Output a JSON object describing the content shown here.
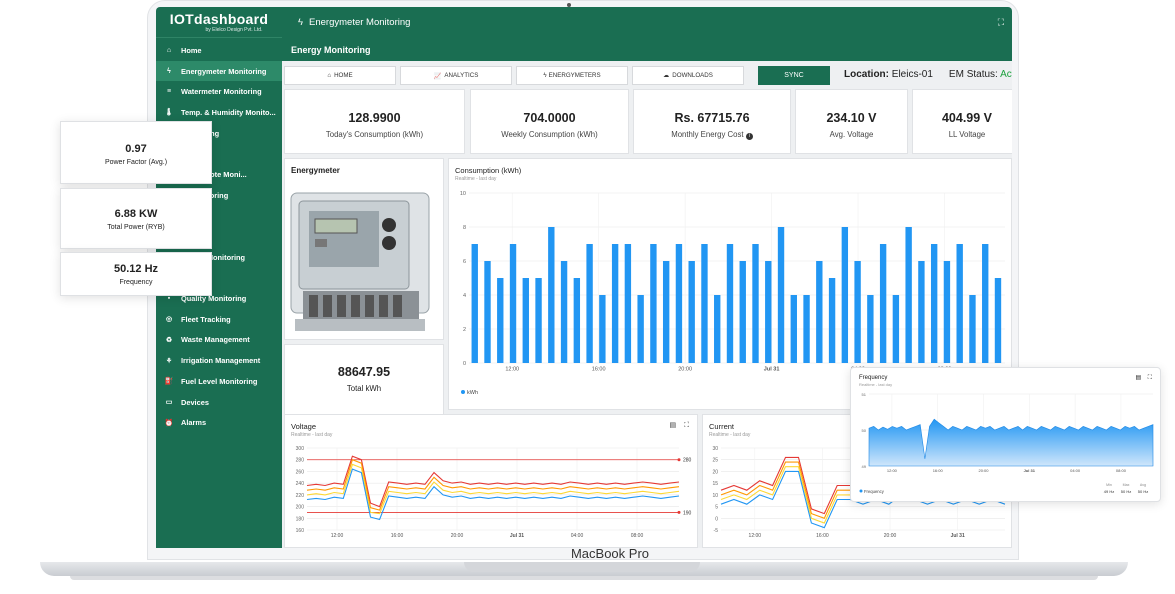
{
  "app": {
    "logo": "IOTdashboard",
    "logo_sub": "by Elelco Design Pvt. Ltd.",
    "title": "Energymeter Monitoring",
    "page_header": "Energy Monitoring",
    "device_label": "MacBook Pro"
  },
  "sidebar": {
    "items": [
      {
        "label": "Home",
        "icon": "home-icon"
      },
      {
        "label": "Energymeter Monitoring",
        "icon": "bolt-icon"
      },
      {
        "label": "Watermeter Monitoring",
        "icon": "water-icon"
      },
      {
        "label": "Temp. & Humidity Monito...",
        "icon": "thermometer-icon"
      },
      {
        "label": "Monitoring",
        "icon": "generic-icon"
      },
      {
        "label": "oring",
        "icon": "generic-icon"
      },
      {
        "label": "mp Remote Moni...",
        "icon": "generic-icon"
      },
      {
        "label": "er Monitoring",
        "icon": "generic-icon"
      },
      {
        "label": "actory",
        "icon": "generic-icon"
      },
      {
        "label": "ffice",
        "icon": "generic-icon"
      },
      {
        "label": "mental Monitoring",
        "icon": "generic-icon"
      },
      {
        "label": "nitoring",
        "icon": "generic-icon"
      },
      {
        "label": "Quality Monitoring",
        "icon": "generic-icon"
      },
      {
        "label": "Fleet Tracking",
        "icon": "fleet-icon"
      },
      {
        "label": "Waste Management",
        "icon": "waste-icon"
      },
      {
        "label": "Irrigation Management",
        "icon": "irrigation-icon"
      },
      {
        "label": "Fuel Level Monitoring",
        "icon": "fuel-icon"
      },
      {
        "label": "Devices",
        "icon": "devices-icon"
      },
      {
        "label": "Alarms",
        "icon": "alarm-icon"
      }
    ]
  },
  "tabs": {
    "home": "HOME",
    "analytics": "ANALYTICS",
    "energymeters": "ENERGYMETERS",
    "downloads": "DOWNLOADS",
    "sync": "SYNC"
  },
  "location": {
    "label": "Location:",
    "value": "Eleics-01"
  },
  "em_status": {
    "label": "EM Status:",
    "value": "Acti"
  },
  "stats": [
    {
      "value": "128.9900",
      "label": "Today's Consumption (kWh)"
    },
    {
      "value": "704.0000",
      "label": "Weekly Consumption (kWh)"
    },
    {
      "value": "Rs. 67715.76",
      "label": "Monthly Energy Cost"
    },
    {
      "value": "234.10 V",
      "label": "Avg. Voltage"
    },
    {
      "value": "404.99 V",
      "label": "LL Voltage"
    }
  ],
  "energymeter": {
    "title": "Energymeter"
  },
  "total_kwh": {
    "value": "88647.95",
    "label": "Total kWh"
  },
  "floating": [
    {
      "value": "0.97",
      "label": "Power Factor (Avg.)"
    },
    {
      "value": "6.88 KW",
      "label": "Total Power (RYB)"
    },
    {
      "value": "50.12 Hz",
      "label": "Frequency"
    }
  ],
  "chart_data": [
    {
      "type": "bar",
      "title": "Consumption (kWh)",
      "subtitle": "Realtime - last day",
      "x_ticks": [
        "12:00",
        "16:00",
        "20:00",
        "Jul 31",
        "04:00",
        "08:00"
      ],
      "ylim": [
        0,
        10
      ],
      "y_ticks": [
        0,
        2,
        4,
        6,
        8,
        10
      ],
      "legend": "kWh",
      "series": [
        {
          "name": "kWh",
          "values": [
            7,
            6,
            5,
            7,
            5,
            5,
            8,
            6,
            5,
            7,
            4,
            7,
            7,
            4,
            7,
            6,
            7,
            6,
            7,
            4,
            7,
            6,
            7,
            6,
            8,
            4,
            4,
            6,
            5,
            8,
            6,
            4,
            7,
            4,
            8,
            6,
            7,
            6,
            7,
            4,
            7,
            5
          ]
        }
      ]
    },
    {
      "type": "line",
      "title": "Voltage",
      "subtitle": "Realtime - last day",
      "x_ticks": [
        "12:00",
        "16:00",
        "20:00",
        "Jul 31",
        "04:00",
        "08:00"
      ],
      "ylim": [
        160,
        300
      ],
      "y_ticks": [
        160,
        180,
        200,
        220,
        240,
        260,
        280,
        300
      ],
      "reference_lines": [
        280,
        190
      ],
      "series": [
        {
          "values": [
            236,
            238,
            236,
            240,
            238,
            286,
            280,
            206,
            200,
            242,
            240,
            238,
            240,
            238,
            258,
            244,
            240,
            242,
            238,
            240,
            238,
            240,
            238,
            240,
            238,
            240,
            238,
            240,
            238,
            242,
            240,
            238,
            240,
            238,
            240,
            238,
            240,
            242,
            240,
            238,
            240,
            242
          ]
        },
        {
          "values": [
            228,
            230,
            228,
            232,
            230,
            280,
            274,
            198,
            194,
            234,
            232,
            230,
            232,
            230,
            250,
            236,
            232,
            234,
            230,
            232,
            230,
            232,
            230,
            232,
            230,
            232,
            230,
            232,
            230,
            234,
            232,
            230,
            232,
            230,
            232,
            230,
            232,
            234,
            232,
            230,
            232,
            234
          ]
        },
        {
          "values": [
            220,
            222,
            220,
            224,
            222,
            272,
            266,
            190,
            188,
            226,
            224,
            222,
            224,
            222,
            242,
            228,
            224,
            226,
            222,
            224,
            222,
            224,
            222,
            224,
            222,
            224,
            222,
            224,
            222,
            226,
            224,
            222,
            224,
            222,
            224,
            222,
            224,
            226,
            224,
            222,
            224,
            226
          ]
        },
        {
          "values": [
            212,
            214,
            212,
            216,
            214,
            264,
            258,
            182,
            178,
            218,
            216,
            214,
            216,
            214,
            234,
            220,
            216,
            218,
            214,
            216,
            214,
            216,
            214,
            216,
            214,
            216,
            214,
            216,
            214,
            218,
            216,
            214,
            216,
            214,
            216,
            214,
            216,
            218,
            216,
            214,
            216,
            218
          ]
        }
      ]
    },
    {
      "type": "line",
      "title": "Current",
      "subtitle": "Realtime - last day",
      "x_ticks": [
        "12:00",
        "16:00",
        "20:00",
        "Jul 31"
      ],
      "ylim": [
        -5,
        30
      ],
      "y_ticks": [
        -5,
        0,
        5,
        10,
        15,
        20,
        25,
        30
      ],
      "series": [
        {
          "values": [
            12,
            14,
            12,
            16,
            14,
            26,
            26,
            4,
            2,
            14,
            14,
            12,
            14,
            12,
            16,
            14,
            12,
            14,
            12,
            14,
            12,
            14,
            12
          ]
        },
        {
          "values": [
            10,
            12,
            10,
            14,
            12,
            24,
            24,
            2,
            0,
            12,
            12,
            10,
            12,
            10,
            14,
            12,
            10,
            12,
            10,
            12,
            10,
            12,
            10
          ]
        },
        {
          "values": [
            8,
            10,
            8,
            12,
            10,
            22,
            22,
            0,
            -2,
            10,
            10,
            8,
            10,
            8,
            12,
            10,
            8,
            10,
            8,
            10,
            8,
            10,
            8
          ]
        },
        {
          "values": [
            6,
            8,
            6,
            10,
            8,
            20,
            20,
            -2,
            -4,
            8,
            8,
            6,
            8,
            6,
            10,
            8,
            6,
            8,
            6,
            8,
            6,
            8,
            6
          ]
        }
      ]
    },
    {
      "type": "area",
      "title": "Frequency",
      "subtitle": "Realtime - last day",
      "x_ticks": [
        "12:00",
        "16:00",
        "20:00",
        "Jul 31",
        "04:00",
        "08:00"
      ],
      "ylim": [
        49,
        51
      ],
      "y_ticks": [
        49,
        50,
        51
      ],
      "legend": "Frequency",
      "stats": [
        {
          "label": "Min",
          "value": "49 Hz"
        },
        {
          "label": "Max",
          "value": "50 Hz"
        },
        {
          "label": "Avg",
          "value": "50 Hz"
        }
      ],
      "series": [
        {
          "name": "Frequency",
          "values": [
            50.05,
            50.1,
            50.0,
            50.08,
            50.02,
            50.1,
            50.05,
            50.1,
            50.0,
            50.05,
            50.1,
            50.15,
            49.2,
            50.1,
            50.3,
            50.2,
            50.1,
            50.0,
            50.1,
            50.05,
            50.0,
            50.1,
            50.05,
            50.0,
            50.1,
            50.05,
            50.1,
            50.0,
            50.05,
            50.1,
            50.0,
            50.05,
            50.1,
            50.0,
            50.1,
            50.05,
            50.0,
            50.1,
            50.05,
            50.0,
            50.1,
            50.05,
            50.0,
            50.1,
            50.05,
            50.0,
            50.1,
            50.05,
            50.0,
            50.1,
            50.05,
            50.0,
            50.1,
            50.05,
            50.0,
            50.1,
            50.05,
            50.1,
            50.0,
            50.05,
            50.1,
            50.15
          ]
        }
      ]
    }
  ]
}
